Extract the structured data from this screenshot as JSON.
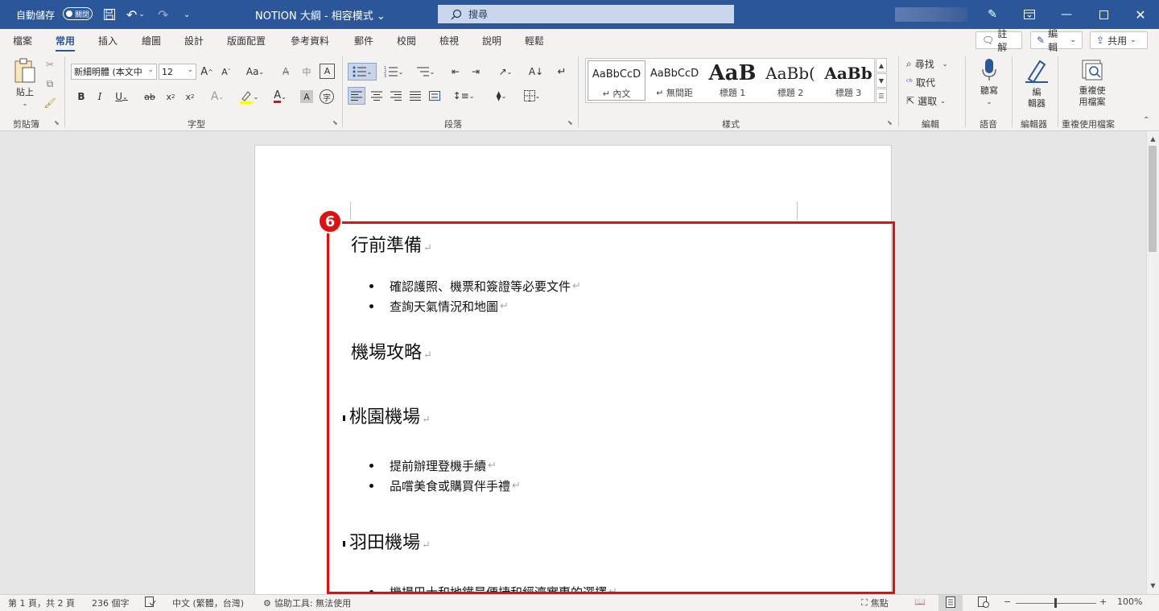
{
  "titlebar": {
    "autosave_label": "自動儲存",
    "autosave_state": "關閉",
    "doc_title": "NOTION 大綱 - 相容模式 ⌄",
    "search_placeholder": "搜尋"
  },
  "ribbon_tabs": [
    "檔案",
    "常用",
    "插入",
    "繪圖",
    "設計",
    "版面配置",
    "參考資料",
    "郵件",
    "校閱",
    "檢視",
    "說明",
    "輕鬆"
  ],
  "active_tab": "常用",
  "ribbon_right": {
    "comment": "註解",
    "edit": "編輯",
    "share": "共用"
  },
  "groups": {
    "clipboard": {
      "label": "剪貼簿",
      "paste": "貼上"
    },
    "font": {
      "label": "字型",
      "font_name": "新細明體 (本文中",
      "font_size": "12"
    },
    "paragraph": {
      "label": "段落"
    },
    "styles": {
      "label": "樣式",
      "items": [
        {
          "preview": "AaBbCcD",
          "name": "↵ 內文"
        },
        {
          "preview": "AaBbCcD",
          "name": "↵ 無間距"
        },
        {
          "preview": "AaB",
          "name": "標題 1"
        },
        {
          "preview": "AaBb(",
          "name": "標題 2"
        },
        {
          "preview": "AaBb",
          "name": "標題 3"
        }
      ]
    },
    "editing": {
      "label": "編輯",
      "find": "尋找",
      "replace": "取代",
      "select": "選取"
    },
    "voice": {
      "label": "語音",
      "dictate": "聽寫"
    },
    "editor": {
      "label": "編輯器",
      "button_line1": "編",
      "button_line2": "輯器"
    },
    "reuse": {
      "label": "重複使用檔案",
      "button_line1": "重複使",
      "button_line2": "用檔案"
    }
  },
  "document": {
    "badge": "6",
    "h1": "行前準備",
    "list1": [
      "確認護照、機票和簽證等必要文件",
      "查詢天氣情況和地圖"
    ],
    "h2": "機場攻略",
    "h3a": "桃園機場",
    "list2": [
      "提前辦理登機手續",
      "品嚐美食或購買伴手禮"
    ],
    "h3b": "羽田機場",
    "list3": [
      "機場巴士和地鐵是便捷和經濟實惠的選擇"
    ],
    "para_mark": "↵"
  },
  "statusbar": {
    "page": "第 1 頁，共 2 頁",
    "words": "236 個字",
    "language": "中文 (繁體，台灣)",
    "accessibility": "協助工具: 無法使用",
    "focus": "焦點",
    "zoom": "100%"
  }
}
